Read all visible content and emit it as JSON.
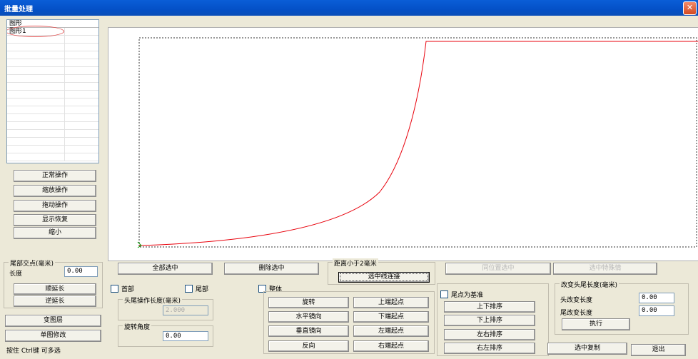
{
  "window": {
    "title": "批量处理",
    "close_glyph": "✕"
  },
  "list": {
    "header": "图形",
    "items": [
      "图形1"
    ]
  },
  "ops": {
    "normal": "正常操作",
    "zoom": "缩放操作",
    "drag": "拖动操作",
    "restore": "显示恢复",
    "shrink": "缩小"
  },
  "tail": {
    "group": "尾部交点(毫米)",
    "length_label": "长度",
    "length_value": "0.00",
    "extend_fwd": "顺延长",
    "extend_back": "逆延长"
  },
  "layer": {
    "change": "变图层",
    "single_edit": "单图修改"
  },
  "hint": "按住 Ctrl键 可多选",
  "select": {
    "all": "全部选中",
    "delete": "删除选中",
    "dist_group": "距离小于2毫米",
    "connect": "选中线连接",
    "same_pos": "同位置选中",
    "special": "选中特殊情"
  },
  "checks": {
    "head": "首部",
    "tail": "尾部",
    "whole": "整体",
    "tail_base": "尾点为基准"
  },
  "head_tail_op": {
    "label": "头尾操作长度(毫米)",
    "value": "2.000"
  },
  "rotate": {
    "label": "旋转角度",
    "value": "0.00"
  },
  "transform": {
    "rotate": "旋转",
    "hmirror": "水平镜向",
    "vmirror": "垂直镜向",
    "reverse": "反向"
  },
  "endpoints": {
    "up": "上端起点",
    "down": "下端起点",
    "left": "左端起点",
    "right": "右端起点"
  },
  "sort": {
    "ud": "上下排序",
    "du": "下上排序",
    "lr": "左右排序",
    "rl": "右左排序"
  },
  "change_len": {
    "group": "改变头尾长度(毫米)",
    "head_label": "头改变长度",
    "head_value": "0.00",
    "tail_label": "尾改变长度",
    "tail_value": "0.00",
    "exec": "执行"
  },
  "copy_sel": "选中复制",
  "exit": "退出",
  "colors": {
    "curve": "#e8000b",
    "titlebar": "#0a5ed7",
    "oval": "#e05050"
  }
}
